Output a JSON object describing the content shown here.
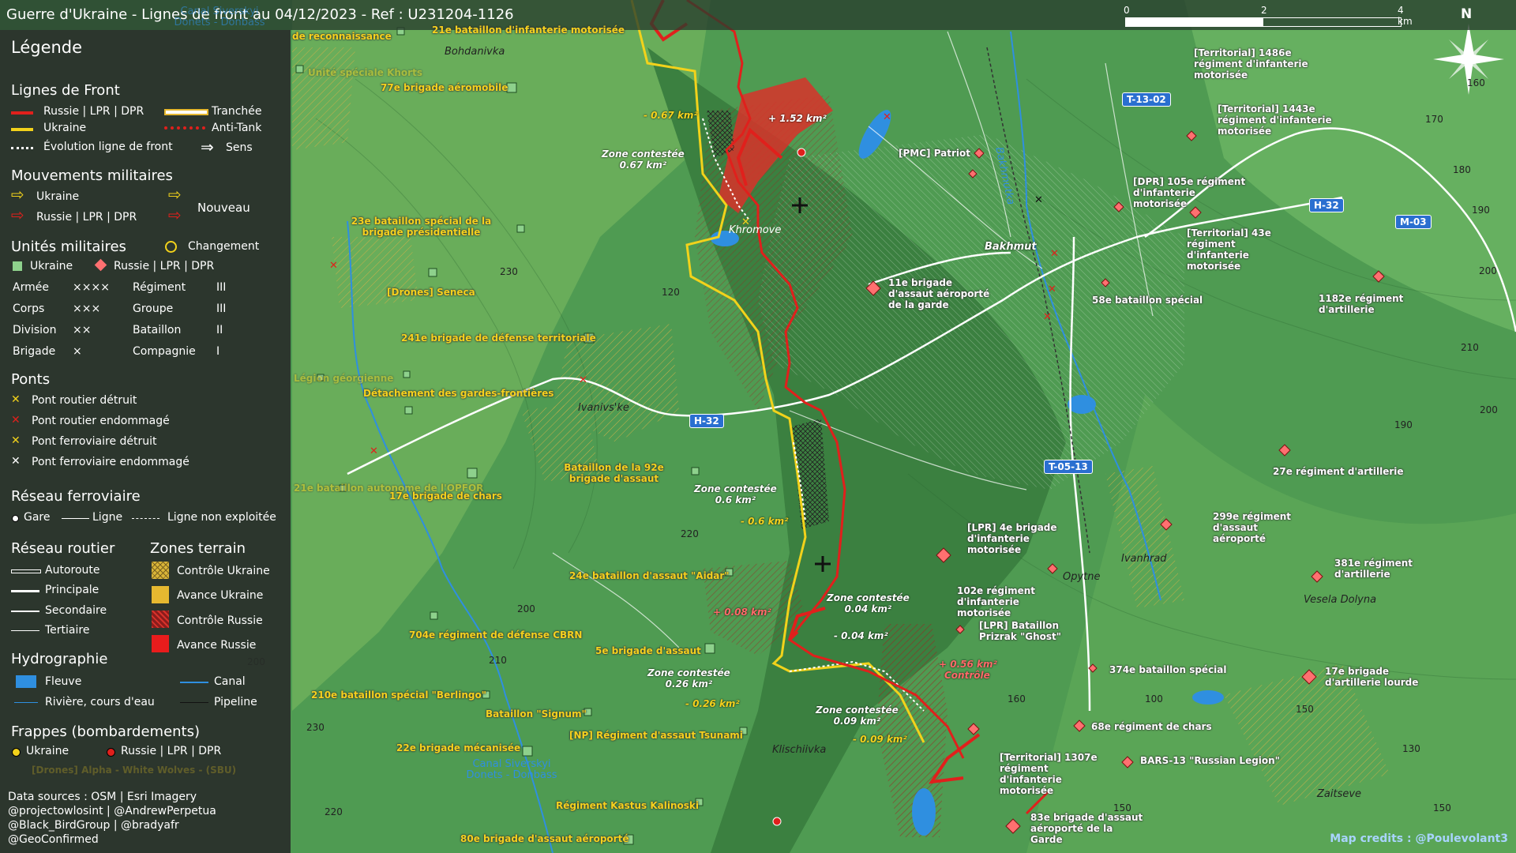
{
  "title": "Guerre d'Ukraine - Lignes de front au 04/12/2023 - Ref : U231204-1126",
  "scale": {
    "ticks": [
      "0",
      "2",
      "4 km"
    ]
  },
  "north": "N",
  "legend": {
    "title": "Légende",
    "front_lines": {
      "heading": "Lignes de Front",
      "russia": "Russie | LPR | DPR",
      "ukraine": "Ukraine",
      "evolution": "Évolution ligne de front",
      "trench": "Tranchée",
      "antitank": "Anti-Tank",
      "direction": "Sens"
    },
    "movements": {
      "heading": "Mouvements militaires",
      "ukraine": "Ukraine",
      "russia": "Russie | LPR | DPR",
      "new": "Nouveau"
    },
    "units": {
      "heading": "Unités militaires",
      "change": "Changement",
      "ukraine": "Ukraine",
      "russia": "Russie | LPR | DPR",
      "rows": [
        [
          "Armée",
          "××××",
          "Régiment",
          "III"
        ],
        [
          "Corps",
          "×××",
          "Groupe",
          "III"
        ],
        [
          "Division",
          "××",
          "Bataillon",
          "II"
        ],
        [
          "Brigade",
          "×",
          "Compagnie",
          "I"
        ]
      ]
    },
    "bridges": {
      "heading": "Ponts",
      "items": [
        "Pont routier détruit",
        "Pont routier endommagé",
        "Pont ferroviaire détruit",
        "Pont ferroviaire endommagé"
      ]
    },
    "rail": {
      "heading": "Réseau ferroviaire",
      "station": "Gare",
      "line": "Ligne",
      "unused": "Ligne non exploitée"
    },
    "roads": {
      "heading": "Réseau routier",
      "items": [
        "Autoroute",
        "Principale",
        "Secondaire",
        "Tertiaire"
      ]
    },
    "zones": {
      "heading": "Zones terrain",
      "items": [
        "Contrôle Ukraine",
        "Avance Ukraine",
        "Contrôle Russie",
        "Avance Russie"
      ]
    },
    "hydro": {
      "heading": "Hydrographie",
      "river": "Fleuve",
      "canal": "Canal",
      "stream": "Rivière, cours d'eau",
      "pipeline": "Pipeline"
    },
    "strikes": {
      "heading": "Frappes (bombardements)",
      "ukraine": "Ukraine",
      "russia": "Russie | LPR | DPR"
    },
    "colors": {
      "russia": "#e0201c",
      "ukraine": "#f2d21b",
      "water": "#2f8fe0",
      "ukraine_zone": "#e6b830",
      "russia_zone": "#d8322a"
    }
  },
  "credits": [
    "Data sources : OSM | Esri Imagery",
    "@projectowlosint | @AndrewPerpetua",
    "@Black_BirdGroup | @bradyafr",
    "@GeoConfirmed"
  ],
  "map_credit": "Map credits : @Poulevolant3",
  "ukraine_units": [
    "21e bataillon d'infanterie motorisée",
    "de reconnaissance",
    "Unité spéciale Khorts",
    "77e brigade aéromobile",
    "23e bataillon spécial de la brigade présidentielle",
    "[Drones] Seneca",
    "241e brigade de défense territoriale",
    "Légion géorgienne",
    "Détachement des gardes-frontières",
    "Bataillon de la 92e brigade d'assaut",
    "21e bataillon autonome de l'OPFOR",
    "17e brigade de chars",
    "24e bataillon d'assaut \"Aidar\"",
    "704e régiment de défense CBRN",
    "5e brigade d'assaut",
    "210e bataillon spécial \"Berlingo\"",
    "Bataillon \"Signum\"",
    "[NP] Régiment d'assaut Tsunami",
    "22e brigade mécanisée",
    "Régiment Kastus Kalinoski",
    "80e brigade d'assaut aéroporté",
    "[Drones] Alpha - White Wolves - (SBU)"
  ],
  "russia_units": [
    "[PMC] Patriot",
    "[Territorial] 1486e régiment d'infanterie motorisée",
    "[Territorial] 1443e régiment d'infanterie motorisée",
    "[DPR] 105e régiment d'infanterie motorisée",
    "[Territorial] 43e régiment d'infanterie motorisée",
    "11e brigade d'assaut aéroporté de la garde",
    "58e bataillon spécial",
    "1182e régiment d'artillerie",
    "27e régiment d'artillerie",
    "299e régiment d'assaut aéroporté",
    "381e régiment d'artillerie",
    "[LPR] 4e brigade d'infanterie motorisée",
    "102e régiment d'infanterie motorisée",
    "[LPR] Bataillon Prizrak \"Ghost\"",
    "374e bataillon spécial",
    "17e brigade d'artillerie lourde",
    "68e régiment de chars",
    "BARS-13 \"Russian Legion\"",
    "[Territorial] 1307e régiment d'infanterie motorisée",
    "83e brigade d'assaut aéroporté de la Garde"
  ],
  "places": [
    "Bohdanivka",
    "Khromove",
    "Bakhmut",
    "Ivanivs'ke",
    "Ivanhrad",
    "Opytne",
    "Vesela Dolyna",
    "Klischiivka",
    "Zaitseve",
    "Bakhmutka",
    "Canal Siverskyi Donets - Donbass",
    "Canal Siverskyi Donets - Donbass"
  ],
  "roads_labels": [
    "T-13-02",
    "H-32",
    "M-03",
    "H-32",
    "T-05-13"
  ],
  "zones": [
    {
      "label": "Zone contestée",
      "area": "0.67 km²"
    },
    {
      "label": "Zone contestée",
      "area": "0.6 km²"
    },
    {
      "label": "Zone contestée",
      "area": "0.04 km²"
    },
    {
      "label": "Zone contestée",
      "area": "0.26 km²"
    },
    {
      "label": "Zone contestée",
      "area": "0.09 km²"
    }
  ],
  "deltas": [
    "- 0.67 km²",
    "+ 1.52 km²",
    "- 0.6 km²",
    "+ 0.08 km²",
    "- 0.04 km²",
    "- 0.26 km²",
    "- 0.09 km²",
    "+ 0.56 km²",
    "Contrôle"
  ],
  "elevations": [
    "230",
    "120",
    "220",
    "200",
    "210",
    "200",
    "230",
    "220",
    "160",
    "170",
    "180",
    "190",
    "200",
    "210",
    "190",
    "200",
    "160",
    "100",
    "150",
    "150",
    "130",
    "150"
  ]
}
